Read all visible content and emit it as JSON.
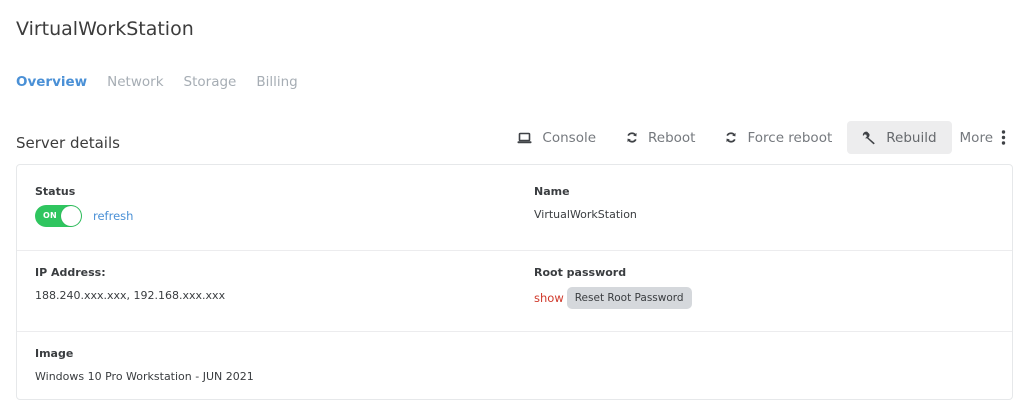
{
  "header": {
    "title": "VirtualWorkStation"
  },
  "tabs": [
    {
      "label": "Overview",
      "active": true
    },
    {
      "label": "Network",
      "active": false
    },
    {
      "label": "Storage",
      "active": false
    },
    {
      "label": "Billing",
      "active": false
    }
  ],
  "section": {
    "title": "Server details"
  },
  "toolbar": {
    "console_label": "Console",
    "reboot_label": "Reboot",
    "force_reboot_label": "Force reboot",
    "rebuild_label": "Rebuild",
    "more_label": "More",
    "icons": [
      "laptop-icon",
      "refresh-icon",
      "refresh-icon",
      "wrench-icon",
      "kebab-icon"
    ]
  },
  "details": {
    "status": {
      "label": "Status",
      "toggle_text": "ON",
      "toggle_on": true,
      "refresh_label": "refresh"
    },
    "name": {
      "label": "Name",
      "value": "VirtualWorkStation"
    },
    "ip": {
      "label": "IP Address:",
      "value": "188.240.xxx.xxx, 192.168.xxx.xxx"
    },
    "root_password": {
      "label": "Root password",
      "show_label": "show",
      "reset_label": "Reset Root Password"
    },
    "image": {
      "label": "Image",
      "value": "Windows 10 Pro Workstation - JUN 2021"
    }
  },
  "colors": {
    "accent": "#4a90d6",
    "toggle_on": "#2fc55f",
    "danger_link": "#d0392b",
    "highlight_button_bg": "#ededee"
  }
}
